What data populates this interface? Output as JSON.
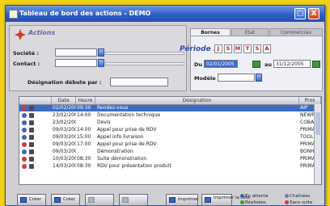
{
  "window": {
    "title": "Tableau de bord des actions - DEMO",
    "close": "X"
  },
  "actions_panel": {
    "title": "Actions",
    "societe_label": "Société :",
    "contact_label": "Contact :",
    "designation_label": "Désignation débute par :"
  },
  "tabs": [
    "Bornes",
    "Etat",
    "Commerciau"
  ],
  "period": {
    "label": "Période :",
    "buttons": [
      "J",
      "S",
      "M",
      "T",
      "S",
      "A"
    ],
    "du_label": "Du",
    "du_value": "02/01/2005",
    "au_label": "au",
    "au_value": "31/12/2005",
    "modele_label": "Modèle :"
  },
  "table": {
    "columns": [
      "Date",
      "Heure",
      "Désignation",
      "Pros"
    ],
    "rows": [
      {
        "date": "02/02/2005",
        "heure": "09:30",
        "designation": "Rendez-vous",
        "pros": "AIP",
        "status": "red"
      },
      {
        "date": "23/02/2005",
        "heure": "14:00",
        "designation": "Documentation technique",
        "pros": "NEWPAR",
        "status": "blue"
      },
      {
        "date": "23/02/2005",
        "heure": "",
        "designation": "Devis",
        "pros": "COBA",
        "status": "blue"
      },
      {
        "date": "09/03/2005",
        "heure": "14:00",
        "designation": "Appel pour prise de RDV",
        "pros": "PRIMA",
        "status": "blue"
      },
      {
        "date": "09/03/2005",
        "heure": "15:00",
        "designation": "Appel info livraison",
        "pros": "TOOLSCL",
        "status": "blue"
      },
      {
        "date": "09/03/2005",
        "heure": "17:00",
        "designation": "Appel pour prise de RDV",
        "pros": "PRIMA",
        "status": "red"
      },
      {
        "date": "09/03/2005",
        "heure": "",
        "designation": "Démonstration",
        "pros": "BONH",
        "status": "blue"
      },
      {
        "date": "10/03/2005",
        "heure": "08:30",
        "designation": "Suite démonstration",
        "pros": "PRIMA",
        "status": "red"
      },
      {
        "date": "14/03/2005",
        "heure": "08:30",
        "designation": "RDV pour présentation produit",
        "pros": "PRIMA",
        "status": "red"
      }
    ]
  },
  "toolbar": {
    "buttons": [
      "Créer",
      "Créer",
      "",
      "",
      "Imprimer",
      "Imprimer la liste"
    ]
  },
  "legend": {
    "en_attente": "En attente",
    "realisees": "Réalisées",
    "chainees": "Chaînées",
    "sans_suite": "Sans suite"
  },
  "colors": {
    "selection": "#3d6cc8",
    "titlebar": "#2f5fc8",
    "background": "#f2cf18"
  }
}
